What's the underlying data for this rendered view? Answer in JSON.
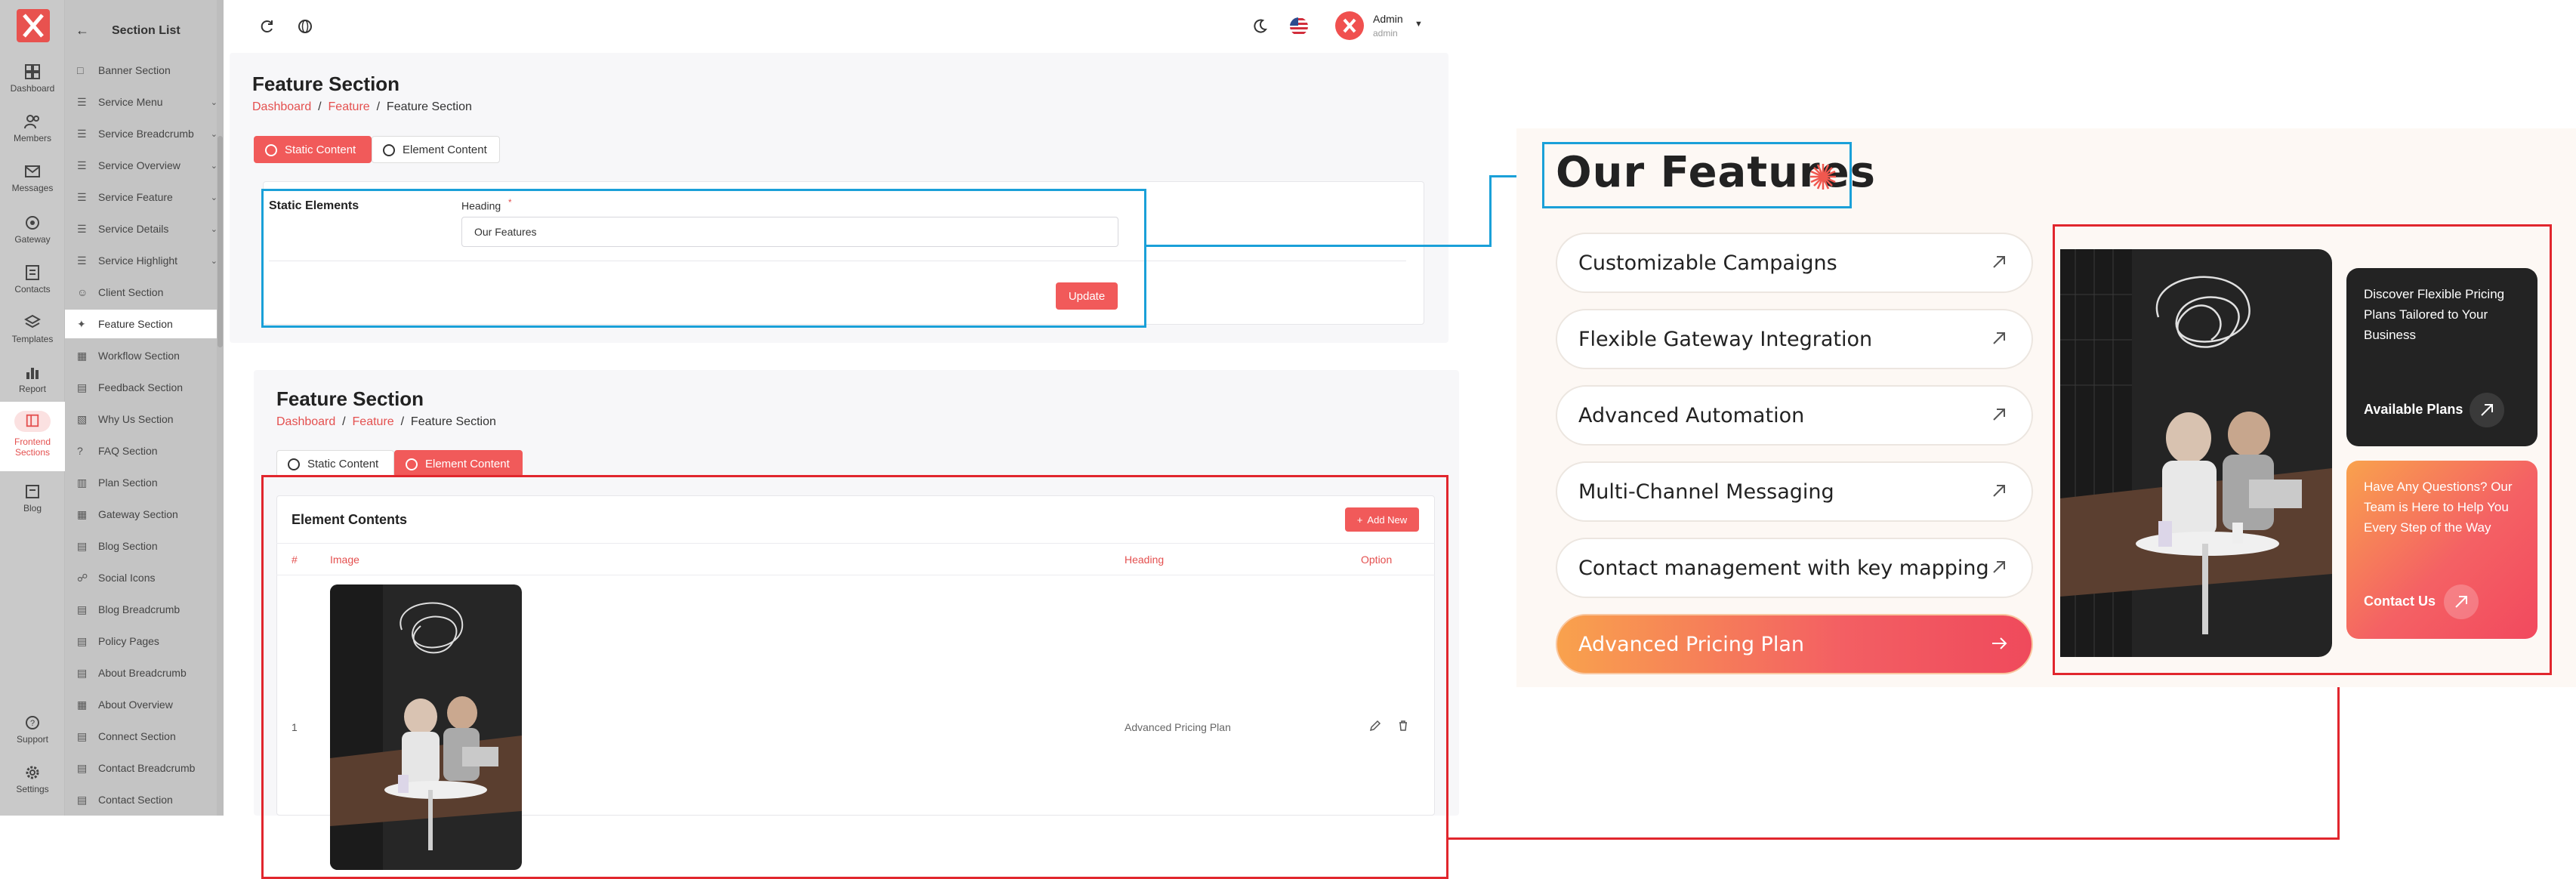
{
  "sidebar": {
    "items": [
      {
        "label": "Dashboard",
        "icon": "grid-icon"
      },
      {
        "label": "Members",
        "icon": "users-icon"
      },
      {
        "label": "Messages",
        "icon": "mail-icon"
      },
      {
        "label": "Gateway",
        "icon": "gateway-icon"
      },
      {
        "label": "Contacts",
        "icon": "contacts-icon"
      },
      {
        "label": "Templates",
        "icon": "layers-icon"
      },
      {
        "label": "Report",
        "icon": "bar-chart-icon"
      },
      {
        "label": "Frontend",
        "label2": "Sections",
        "icon": "frontend-icon",
        "active": true
      },
      {
        "label": "Blog",
        "icon": "blog-icon"
      },
      {
        "label": "Support",
        "icon": "help-icon"
      },
      {
        "label": "Settings",
        "icon": "gear-icon"
      }
    ]
  },
  "section_list": {
    "title": "Section List",
    "items": [
      {
        "label": "Banner Section",
        "chevron": false
      },
      {
        "label": "Service Menu",
        "chevron": true
      },
      {
        "label": "Service Breadcrumb",
        "chevron": true
      },
      {
        "label": "Service Overview",
        "chevron": true
      },
      {
        "label": "Service Feature",
        "chevron": true
      },
      {
        "label": "Service Details",
        "chevron": true
      },
      {
        "label": "Service Highlight",
        "chevron": true
      },
      {
        "label": "Client Section",
        "chevron": false
      },
      {
        "label": "Feature Section",
        "chevron": false,
        "active": true
      },
      {
        "label": "Workflow Section",
        "chevron": false
      },
      {
        "label": "Feedback Section",
        "chevron": false
      },
      {
        "label": "Why Us Section",
        "chevron": false
      },
      {
        "label": "FAQ Section",
        "chevron": false
      },
      {
        "label": "Plan Section",
        "chevron": false
      },
      {
        "label": "Gateway Section",
        "chevron": false
      },
      {
        "label": "Blog Section",
        "chevron": false
      },
      {
        "label": "Social Icons",
        "chevron": false
      },
      {
        "label": "Blog Breadcrumb",
        "chevron": false
      },
      {
        "label": "Policy Pages",
        "chevron": false
      },
      {
        "label": "About Breadcrumb",
        "chevron": false
      },
      {
        "label": "About Overview",
        "chevron": false
      },
      {
        "label": "Connect Section",
        "chevron": false
      },
      {
        "label": "Contact Breadcrumb",
        "chevron": false
      },
      {
        "label": "Contact Section",
        "chevron": false
      }
    ]
  },
  "topbar": {
    "user_name": "Admin",
    "user_role": "admin"
  },
  "static_card": {
    "title": "Feature Section",
    "breadcrumb": [
      "Dashboard",
      "Feature",
      "Feature Section"
    ],
    "tabs": [
      "Static Content",
      "Element Content"
    ],
    "group_label": "Static Elements",
    "heading_label": "Heading",
    "required_mark": "*",
    "heading_value": "Our Features",
    "update_label": "Update"
  },
  "element_card": {
    "title": "Feature Section",
    "breadcrumb": [
      "Dashboard",
      "Feature",
      "Feature Section"
    ],
    "tabs": [
      "Static Content",
      "Element Content"
    ],
    "table_title": "Element Contents",
    "add_new_label": "Add New",
    "columns": [
      "#",
      "Image",
      "Heading",
      "Option"
    ],
    "rows": [
      {
        "index": "1",
        "heading": "Advanced Pricing Plan"
      }
    ]
  },
  "preview": {
    "title": "Our Features",
    "features": [
      "Customizable Campaigns",
      "Flexible Gateway Integration",
      "Advanced Automation",
      "Multi-Channel Messaging",
      "Contact management with key mapping",
      "Advanced Pricing Plan"
    ],
    "card_dark": {
      "text": "Discover Flexible Pricing Plans Tailored to Your Business",
      "link": "Available Plans"
    },
    "card_gradient": {
      "text": "Have Any Questions? Our Team is Here to Help You Every Step of the Way",
      "link": "Contact Us"
    }
  },
  "colors": {
    "accent": "#f15a5a",
    "callout_blue": "#1aa0d8",
    "callout_red": "#e1262d",
    "gradient_start": "#f9a24d",
    "gradient_end": "#ef4a5c",
    "dark_card": "#232323"
  }
}
